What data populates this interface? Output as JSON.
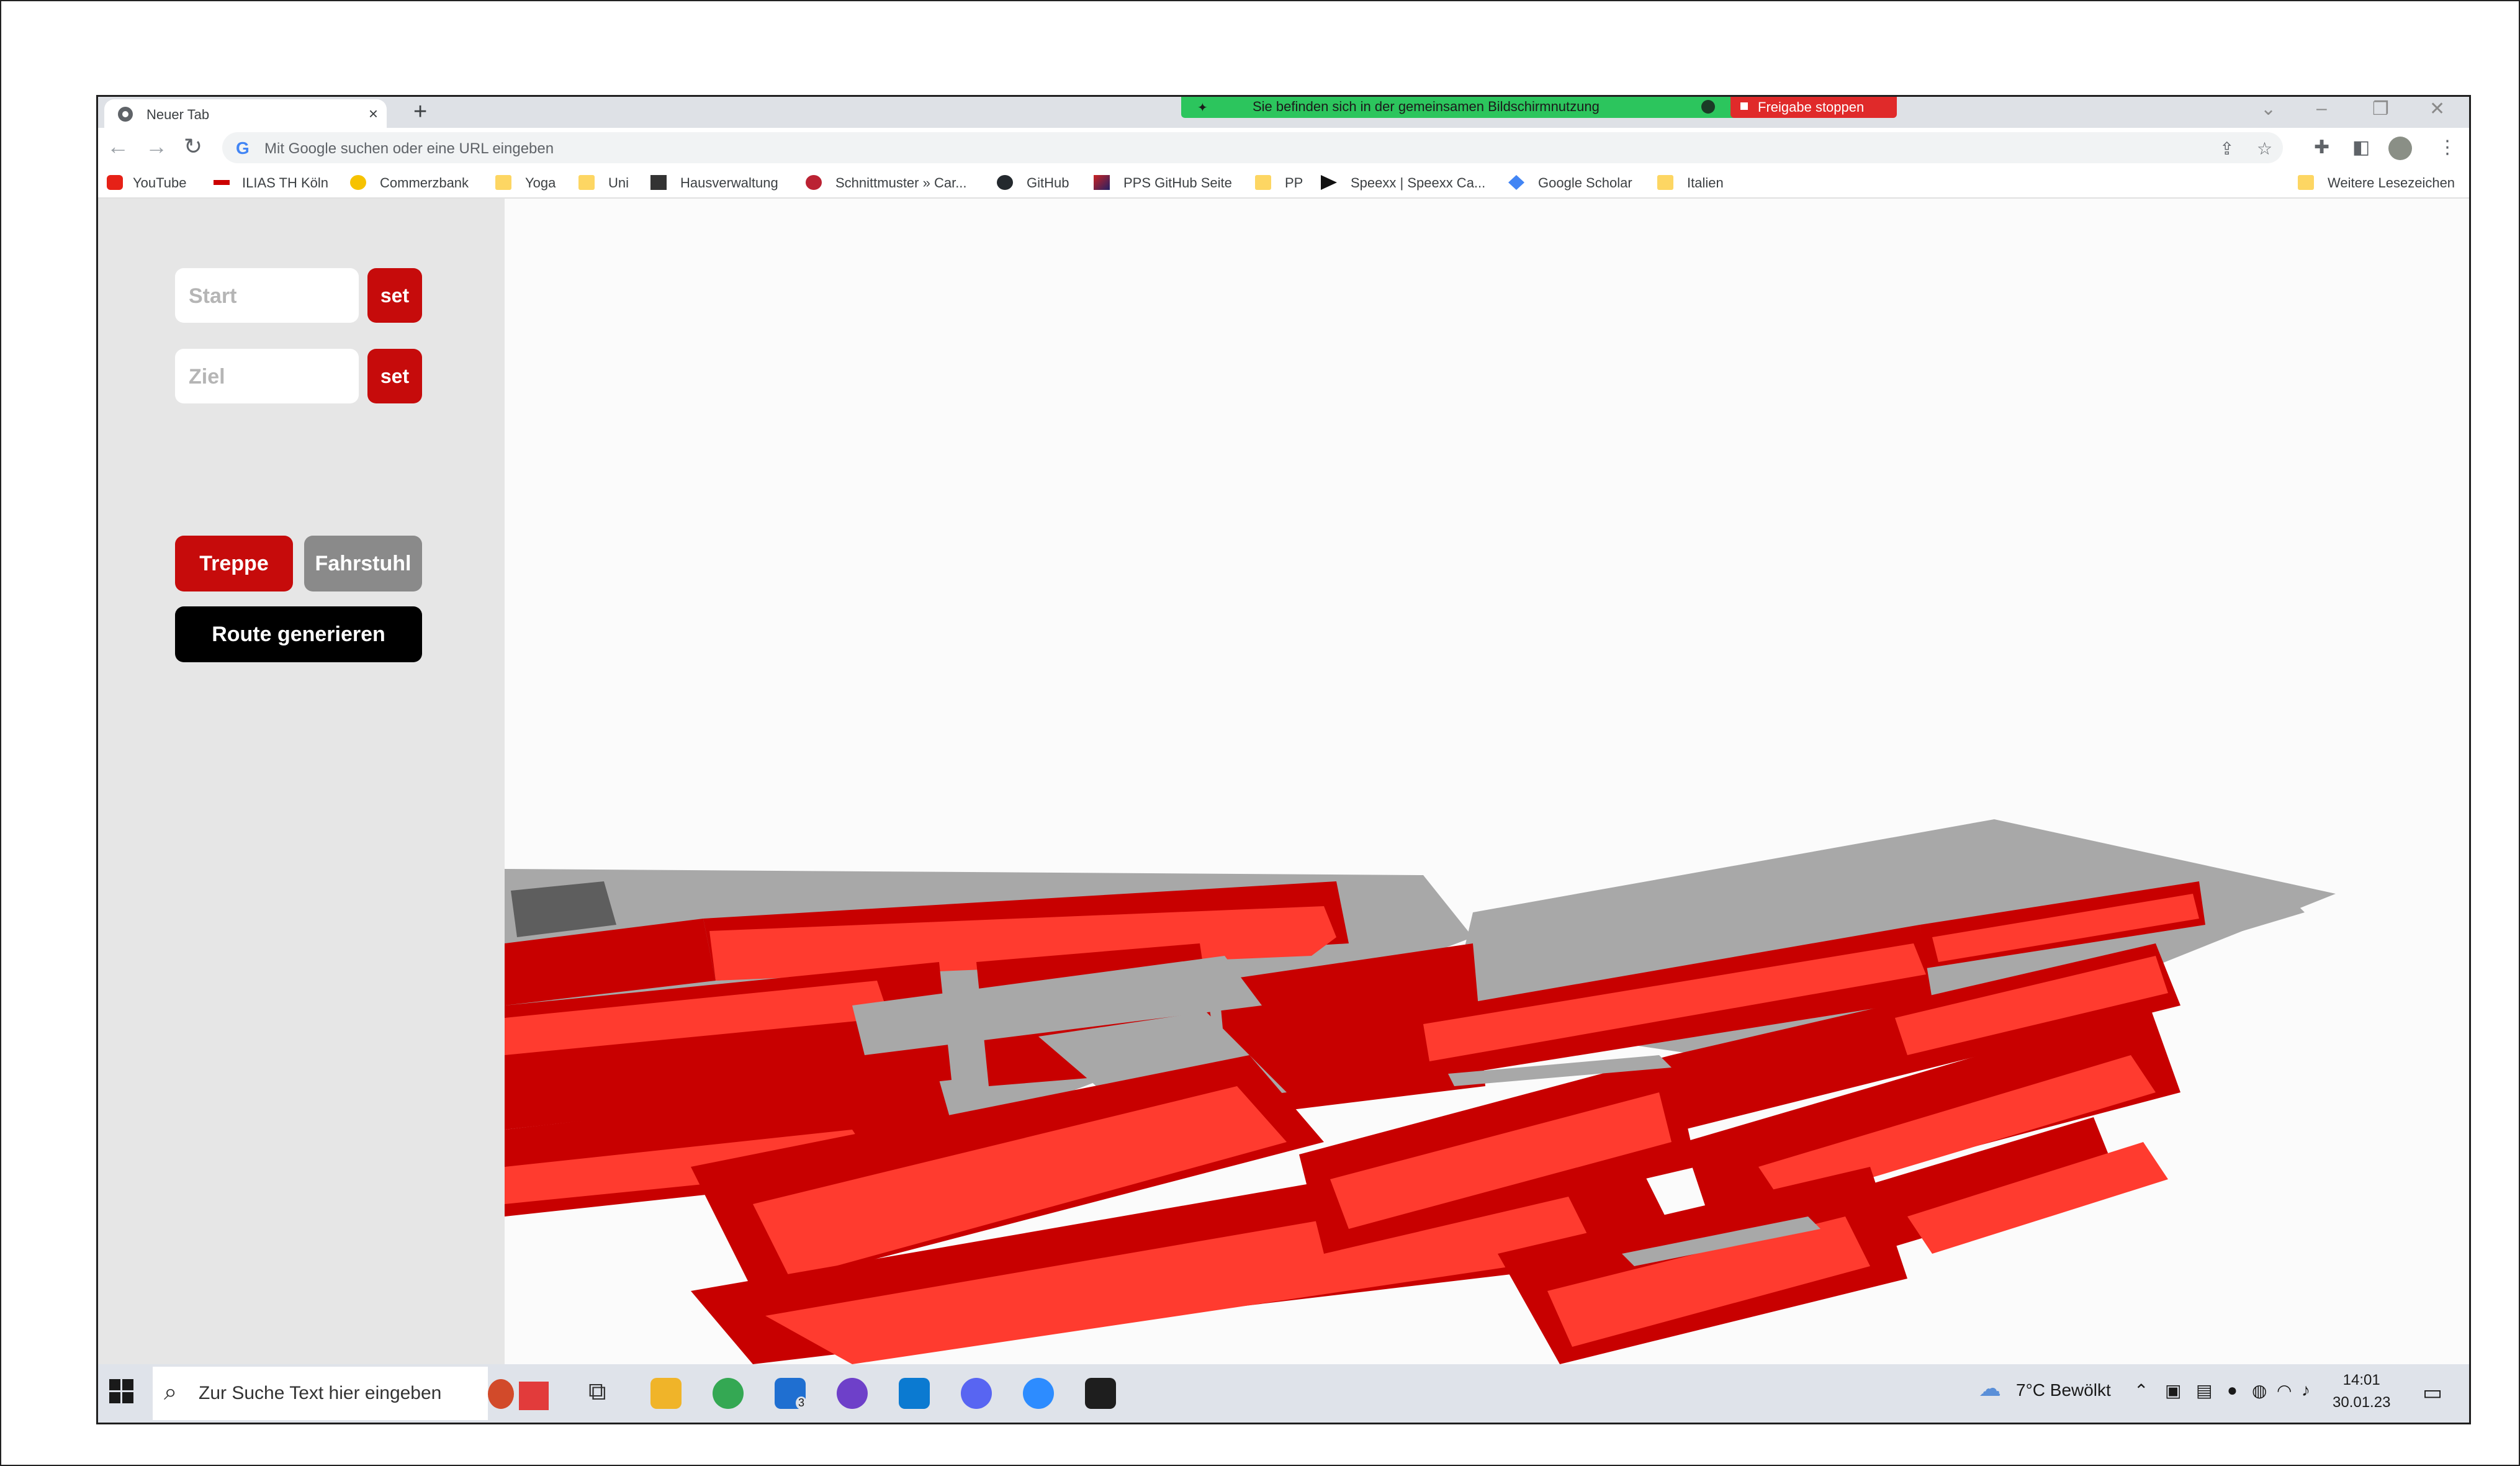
{
  "browser": {
    "tab_title": "Neuer Tab",
    "tab_close": "×",
    "new_tab": "+",
    "share_banner": "Sie befinden sich in der gemeinsamen Bildschirmnutzung",
    "stop_share": "Freigabe stoppen",
    "omnibox_placeholder": "Mit Google suchen oder eine URL eingeben",
    "bookmarks": [
      {
        "label": "YouTube",
        "icon": "youtube-icon"
      },
      {
        "label": "ILIAS TH Köln",
        "icon": "ilias-icon"
      },
      {
        "label": "Commerzbank",
        "icon": "commerzbank-icon"
      },
      {
        "label": "Yoga",
        "icon": "folder-icon"
      },
      {
        "label": "Uni",
        "icon": "folder-icon"
      },
      {
        "label": "Hausverwaltung",
        "icon": "hausverwaltung-icon"
      },
      {
        "label": "Schnittmuster » Car...",
        "icon": "schnittmuster-icon"
      },
      {
        "label": "GitHub",
        "icon": "github-icon"
      },
      {
        "label": "PPS GitHub Seite",
        "icon": "pps-icon"
      },
      {
        "label": "PP",
        "icon": "folder-icon"
      },
      {
        "label": "Speexx | Speexx Ca...",
        "icon": "speexx-icon"
      },
      {
        "label": "Google Scholar",
        "icon": "scholar-icon"
      },
      {
        "label": "Italien",
        "icon": "folder-icon"
      }
    ],
    "other_bookmarks": "Weitere Lesezeichen"
  },
  "app": {
    "start_placeholder": "Start",
    "ziel_placeholder": "Ziel",
    "set_label": "set",
    "treppe_label": "Treppe",
    "fahrstuhl_label": "Fahrstuhl",
    "route_label": "Route generieren",
    "colors": {
      "accent": "#c60b0b",
      "inactive": "#8a8a8a",
      "room_top": "#ff3b2f",
      "room_side": "#c80000",
      "floor": "#a8a8a8"
    }
  },
  "taskbar": {
    "search_placeholder": "Zur Suche Text hier eingeben",
    "mail_badge": "3",
    "weather": "7°C  Bewölkt",
    "time": "14:01",
    "date": "30.01.23"
  }
}
